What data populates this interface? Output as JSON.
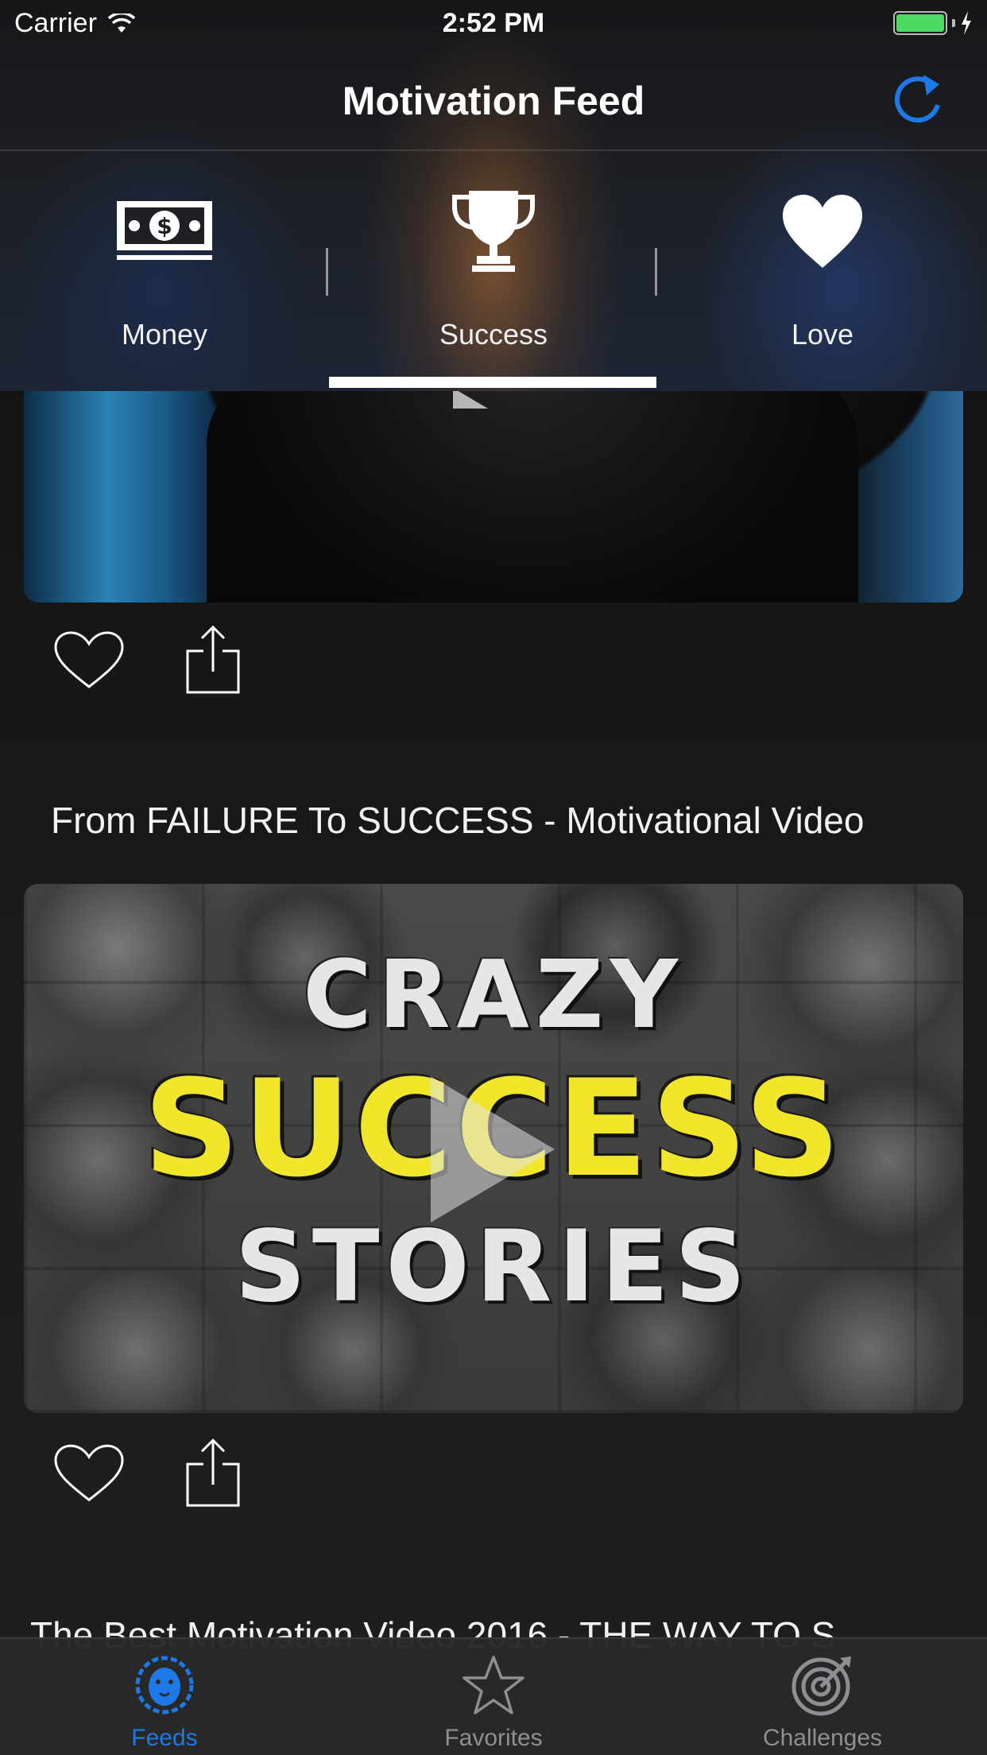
{
  "status_bar": {
    "carrier": "Carrier",
    "time": "2:52 PM"
  },
  "nav": {
    "title": "Motivation Feed",
    "refresh_icon": "refresh-icon",
    "accent": "#1e78e6"
  },
  "categories": [
    {
      "label": "Money",
      "icon": "money-bill-icon"
    },
    {
      "label": "Success",
      "icon": "trophy-icon",
      "selected": true
    },
    {
      "label": "Love",
      "icon": "heart-icon"
    }
  ],
  "feed": {
    "items": [
      {
        "title": "",
        "thumbnail": "video-thumbnail-man-in-suit"
      },
      {
        "title": "From FAILURE To SUCCESS - Motivational Video",
        "thumbnail_text": {
          "line1": "CRAZY",
          "line2": "SUCCESS",
          "line3": "STORIES"
        }
      },
      {
        "title": "The Best Motivation Video 2016 - THE WAY TO S"
      }
    ]
  },
  "tabbar": {
    "items": [
      {
        "label": "Feeds",
        "icon": "lion-icon",
        "active": true
      },
      {
        "label": "Favorites",
        "icon": "star-icon"
      },
      {
        "label": "Challenges",
        "icon": "target-icon"
      }
    ],
    "active_color": "#1e78e6",
    "inactive_color": "#8e8e93"
  }
}
